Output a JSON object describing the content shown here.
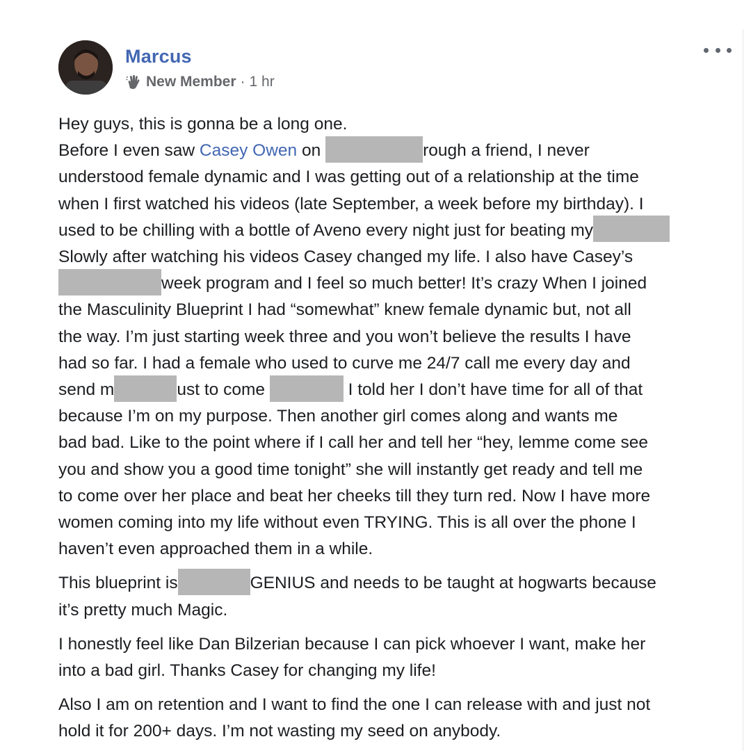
{
  "post": {
    "author": "Marcus",
    "badge_icon": "wave-icon",
    "role": "New Member",
    "separator": "·",
    "time": "1 hr",
    "more_icon": "more-options-icon",
    "link_color": "#4267b2",
    "redaction_color": "#b6b6b6",
    "body": {
      "l1": "Hey guys, this is gonna be a long one.",
      "l2a": "Before I even saw ",
      "l2_link": "Casey Owen",
      "l2b": " on ",
      "l2c": "rough a friend, I never",
      "l3": "understood female dynamic and I was getting out of a relationship at the time",
      "l4": "when I first watched his videos (late September, a week before my birthday). I",
      "l5": "used to be chilling with a bottle of Aveno every night just for beating my",
      "l6": "Slowly after watching his videos Casey changed my life. I also have Casey’s",
      "l7": "week program and I feel so much better! It’s crazy When I joined",
      "l8": "the Masculinity Blueprint I had “somewhat” knew female dynamic but, not all",
      "l9": "the way. I’m just starting week three and you won’t believe the results I have",
      "l10": "had so far. I had a female who used to curve me 24/7 call me every day and",
      "l11a": "send m",
      "l11b": "ust to come",
      "l11c": " I told her I don’t have time for all of that",
      "l12": "because I’m on my purpose. Then another girl comes along and wants me",
      "l13": "bad bad. Like to the point where if I call her and tell her “hey, lemme come see",
      "l14": "you and show you a good time tonight” she will instantly get ready and tell me",
      "l15": "to come over her place and beat her cheeks till they turn red. Now I have more",
      "l16": "women coming into my life without even TRYING. This is all over the phone I",
      "l17": "haven’t even approached them in a while.",
      "p2a": "This blueprint is",
      "p2b": "GENIUS and needs to be taught at hogwarts because",
      "p2c": "it’s pretty much Magic.",
      "p3a": "I honestly feel like Dan Bilzerian because I can pick whoever I want, make her",
      "p3b": "into a bad girl. Thanks Casey for changing my life!",
      "p4a": "Also I am on retention and I want to find the one I can release with and just not",
      "p4b": "hold it for 200+ days. I’m not wasting my seed on anybody."
    }
  }
}
